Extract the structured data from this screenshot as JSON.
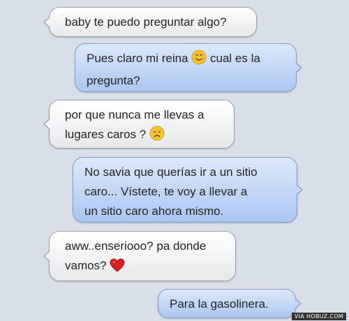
{
  "messages": [
    {
      "side": "received",
      "text": "baby te puedo preguntar algo?"
    },
    {
      "side": "sent",
      "lines": [
        "Pues claro mi reina",
        "cual es la",
        "pregunta?"
      ],
      "emoji": "smiling-face-icon"
    },
    {
      "side": "received",
      "lines": [
        "por que nunca me llevas a",
        "lugares caros ?"
      ],
      "emoji": "disappointed-face-icon"
    },
    {
      "side": "sent",
      "lines": [
        "No savia que querías ir a un sitio",
        "caro... Vístete, te voy a llevar a",
        "un sitio caro ahora mismo."
      ]
    },
    {
      "side": "received",
      "lines": [
        "aww..enseriooo? pa donde",
        "vamos?"
      ],
      "emoji": "red-heart-icon"
    },
    {
      "side": "sent",
      "text": "Para la gasolinera."
    }
  ],
  "watermark": "VIA HOBUZ.COM",
  "colors": {
    "background": "#d9dfe8",
    "received_bubble": "#f3f4f5",
    "sent_bubble": "#b9d0f3",
    "heart": "#d81e1e",
    "emoji_face": "#f7c531"
  }
}
